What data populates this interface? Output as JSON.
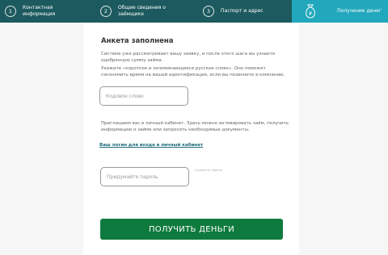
{
  "stepper": {
    "steps": [
      {
        "number": "1",
        "label_line1": "Контактная",
        "label_line2": "информация"
      },
      {
        "number": "2",
        "label_line1": "Общие сведения о",
        "label_line2": "заёмщике"
      },
      {
        "number": "3",
        "label_line1": "Паспорт и адрес"
      },
      {
        "label_line1": "Получение денег",
        "icon": "money-bag-icon",
        "active": true
      }
    ]
  },
  "form": {
    "title": "Анкета заполнена",
    "intro": "Система уже рассматривает вашу заявку, и после этого шага вы узнаете одобренную сумму займа.",
    "codeword_text": "Укажите «короткое и запоминающееся русское слово». Оно поможет сэкономить время на вашей идентификации, если вы позвоните в компанию.",
    "codeword_placeholder": "Кодовое слово",
    "cabinet_text": "Приглашаем вас в личный кабинет. Здесь можно активировать заём, получить информацию о займе или запросить необходимые документы.",
    "login_link": "Ваш логин для входа в личный кабинет",
    "password_placeholder": "Придумайте пароль",
    "password_hint": "Сложность пароля",
    "submit_label": "ПОЛУЧИТЬ ДЕНЬГИ"
  },
  "colors": {
    "header_bg": "#1d5a5f",
    "active_step": "#22a8bc",
    "submit_bg": "#0f7a3e"
  }
}
